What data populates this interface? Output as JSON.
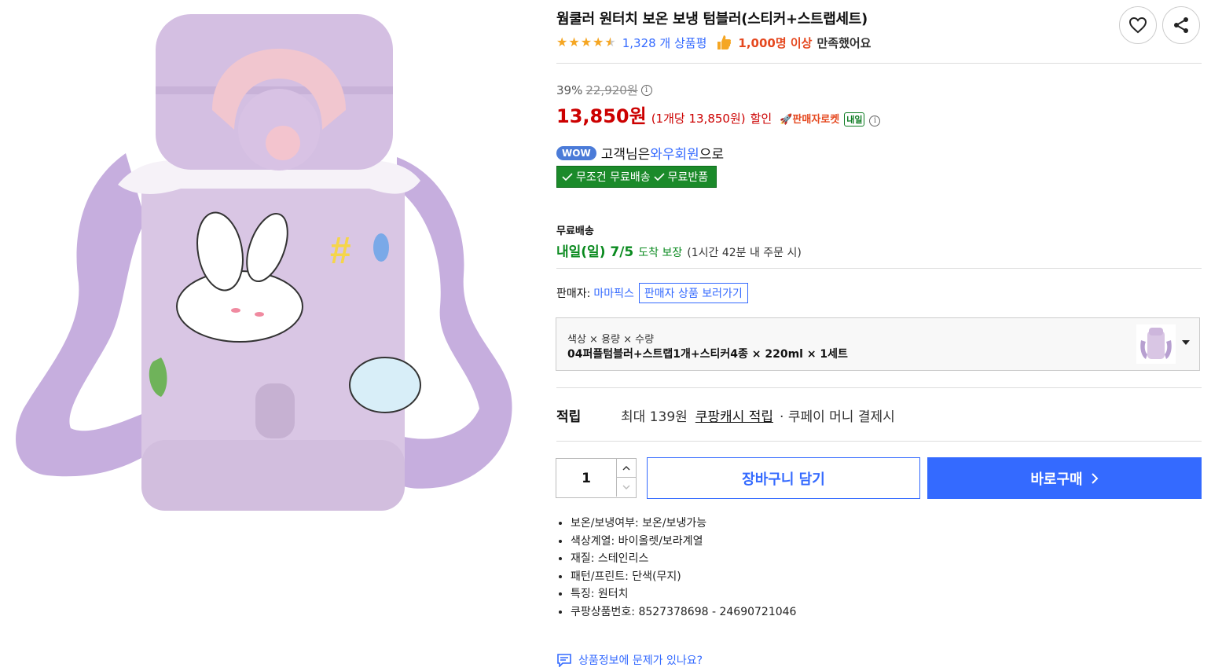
{
  "product": {
    "title": "웜쿨러 원터치 보온 보냉 텀블러(스티커+스트랩세트)",
    "rating": 4.5,
    "review_count": "1,328 개 상품평",
    "satisfied_count": "1,000명 이상",
    "satisfied_suffix": "만족했어요"
  },
  "price": {
    "discount_rate": "39%",
    "original_price": "22,920원",
    "sale_price": "13,850원",
    "unit_price": "(1개당 13,850원)",
    "suffix": "할인",
    "rocket_badge": "판매자로켓",
    "tomorrow_badge": "내일"
  },
  "membership": {
    "wow_badge": "WOW",
    "prefix": "고객님은 ",
    "member": "와우회원",
    "suffix": "으로",
    "free_shipping": "무조건 무료배송",
    "free_return": "무료반품"
  },
  "shipping": {
    "label": "무료배송",
    "date": "내일(일) 7/5",
    "guarantee": "도착 보장",
    "condition": "(1시간 42분 내 주문 시)"
  },
  "seller": {
    "label": "판매자:",
    "name": "마마픽스",
    "link": "판매자 상품 보러가기"
  },
  "option": {
    "label": "색상 × 용량 × 수량",
    "value": "04퍼플텀블러+스트랩1개+스티커4종 × 220ml × 1세트"
  },
  "points": {
    "label": "적립",
    "max": "최대 139원",
    "link": "쿠팡캐시 적립",
    "suffix": "· 쿠페이 머니 결제시"
  },
  "purchase": {
    "quantity": "1",
    "cart_label": "장바구니 담기",
    "buy_label": "바로구매"
  },
  "attributes": [
    "보온/보냉여부: 보온/보냉가능",
    "색상계열: 바이올렛/보라계열",
    "재질: 스테인리스",
    "패턴/프린트: 단색(무지)",
    "특징: 원터치",
    "쿠팡상품번호: 8527378698 - 24690721046"
  ],
  "report": {
    "label": "상품정보에 문제가 있나요?"
  },
  "colors": {
    "accent_blue": "#346aff",
    "price_red": "#cc0000",
    "delivery_green": "#0a8a1f",
    "product_lavender": "#d8c4e4"
  },
  "icons": [
    "heart-icon",
    "share-icon",
    "star-icon",
    "thumbs-up-icon",
    "info-icon",
    "rocket-icon",
    "check-icon",
    "chevron-down-icon",
    "chevron-right-icon",
    "chat-icon"
  ]
}
